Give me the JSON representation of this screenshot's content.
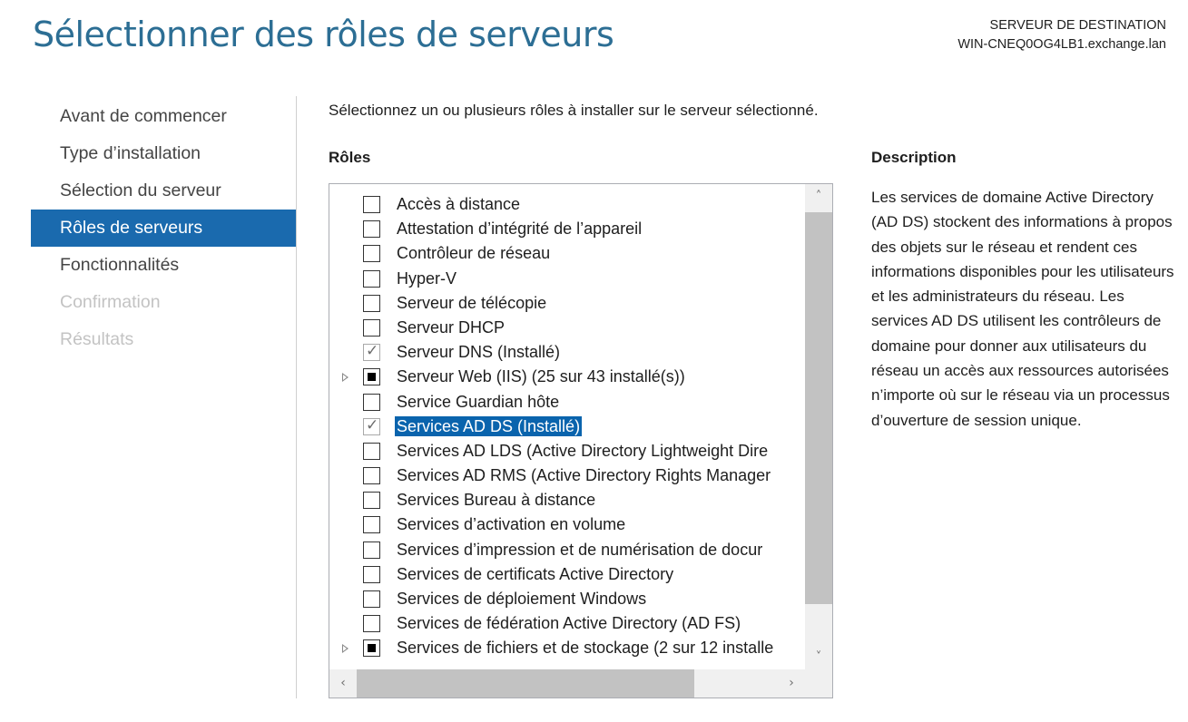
{
  "header": {
    "title": "Sélectionner des rôles de serveurs",
    "destination_label": "SERVEUR DE DESTINATION",
    "destination_server": "WIN-CNEQ0OG4LB1.exchange.lan"
  },
  "nav": {
    "items": [
      {
        "label": "Avant de commencer",
        "state": "normal"
      },
      {
        "label": "Type d’installation",
        "state": "normal"
      },
      {
        "label": "Sélection du serveur",
        "state": "normal"
      },
      {
        "label": "Rôles de serveurs",
        "state": "active"
      },
      {
        "label": "Fonctionnalités",
        "state": "normal"
      },
      {
        "label": "Confirmation",
        "state": "disabled"
      },
      {
        "label": "Résultats",
        "state": "disabled"
      }
    ]
  },
  "main": {
    "intro": "Sélectionnez un ou plusieurs rôles à installer sur le serveur sélectionné.",
    "roles_heading": "Rôles",
    "roles": [
      {
        "label": "Accès à distance",
        "check": "unchecked",
        "expandable": false,
        "selected": false
      },
      {
        "label": "Attestation d’intégrité de l’appareil",
        "check": "unchecked",
        "expandable": false,
        "selected": false
      },
      {
        "label": "Contrôleur de réseau",
        "check": "unchecked",
        "expandable": false,
        "selected": false
      },
      {
        "label": "Hyper-V",
        "check": "unchecked",
        "expandable": false,
        "selected": false
      },
      {
        "label": "Serveur de télécopie",
        "check": "unchecked",
        "expandable": false,
        "selected": false
      },
      {
        "label": "Serveur DHCP",
        "check": "unchecked",
        "expandable": false,
        "selected": false
      },
      {
        "label": "Serveur DNS (Installé)",
        "check": "checked-disabled",
        "expandable": false,
        "selected": false
      },
      {
        "label": "Serveur Web (IIS) (25 sur 43 installé(s))",
        "check": "partial",
        "expandable": true,
        "selected": false
      },
      {
        "label": "Service Guardian hôte",
        "check": "unchecked",
        "expandable": false,
        "selected": false
      },
      {
        "label": "Services AD DS (Installé)",
        "check": "checked-disabled",
        "expandable": false,
        "selected": true
      },
      {
        "label": "Services AD LDS (Active Directory Lightweight Dire",
        "check": "unchecked",
        "expandable": false,
        "selected": false
      },
      {
        "label": "Services AD RMS (Active Directory Rights Manager",
        "check": "unchecked",
        "expandable": false,
        "selected": false
      },
      {
        "label": "Services Bureau à distance",
        "check": "unchecked",
        "expandable": false,
        "selected": false
      },
      {
        "label": "Services d’activation en volume",
        "check": "unchecked",
        "expandable": false,
        "selected": false
      },
      {
        "label": "Services d’impression et de numérisation de docur",
        "check": "unchecked",
        "expandable": false,
        "selected": false
      },
      {
        "label": "Services de certificats Active Directory",
        "check": "unchecked",
        "expandable": false,
        "selected": false
      },
      {
        "label": "Services de déploiement Windows",
        "check": "unchecked",
        "expandable": false,
        "selected": false
      },
      {
        "label": "Services de fédération Active Directory (AD FS)",
        "check": "unchecked",
        "expandable": false,
        "selected": false
      },
      {
        "label": "Services de fichiers et de stockage (2 sur 12 installe",
        "check": "partial",
        "expandable": true,
        "selected": false
      }
    ],
    "scroll": {
      "up_icon": "˄",
      "down_icon": "˅",
      "left_icon": "‹",
      "right_icon": "›"
    },
    "description_heading": "Description",
    "description_text": "Les services de domaine Active Directory (AD DS) stockent des informations à propos des objets sur le réseau et rendent ces informations disponibles pour les utilisateurs et les administrateurs du réseau. Les services AD DS utilisent les contrôleurs de domaine pour donner aux utilisateurs du réseau un accès aux ressources autorisées n’importe où sur le réseau via un processus d’ouverture de session unique."
  },
  "colors": {
    "title": "#2c6e94",
    "nav_active_bg": "#1a6aae",
    "selection_bg": "#0a64ad",
    "disabled_text": "#c3c3c3"
  }
}
